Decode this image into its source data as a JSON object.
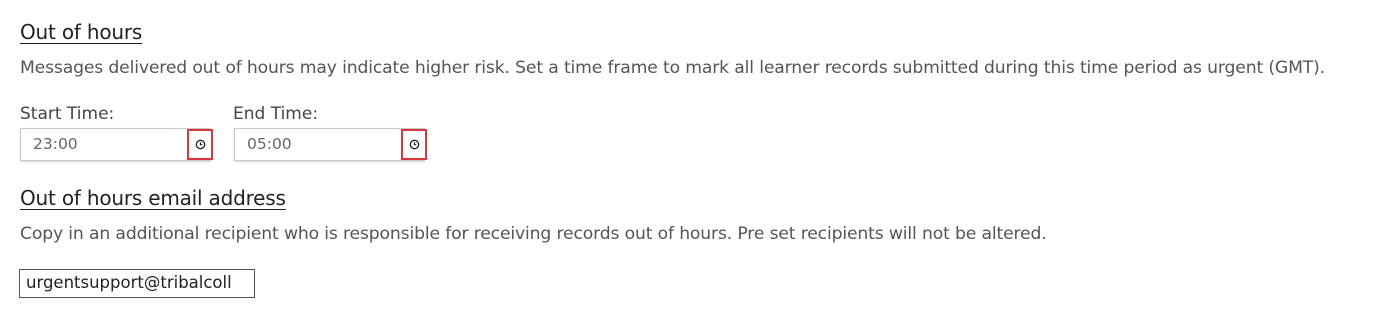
{
  "out_of_hours": {
    "heading": "Out of hours",
    "description": "Messages delivered out of hours may indicate higher risk. Set a time frame to mark all learner records submitted during this time period as urgent (GMT).",
    "start_time": {
      "label": "Start Time:",
      "value": "23:00",
      "icon": "clock-icon"
    },
    "end_time": {
      "label": "End Time:",
      "value": "05:00",
      "icon": "clock-icon"
    }
  },
  "email_section": {
    "heading": "Out of hours email address",
    "description": "Copy in an additional recipient who is responsible for receiving records out of hours. Pre set recipients will not be altered.",
    "email_value": "urgentsupport@tribalcoll"
  },
  "colors": {
    "highlight_border": "#d9363e",
    "text": "#555555",
    "heading": "#222222"
  }
}
